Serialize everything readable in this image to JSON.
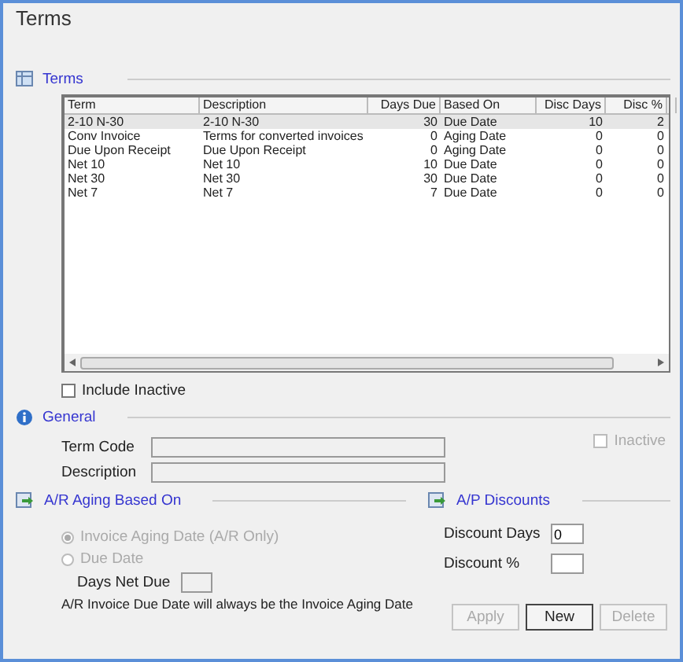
{
  "window": {
    "title": "Terms"
  },
  "terms_section": {
    "title": "Terms"
  },
  "table": {
    "columns": [
      {
        "label": "Term",
        "kind": "text"
      },
      {
        "label": "Description",
        "kind": "text"
      },
      {
        "label": "Days Due",
        "kind": "number"
      },
      {
        "label": "Based On",
        "kind": "text"
      },
      {
        "label": "Disc Days",
        "kind": "number"
      },
      {
        "label": "Disc %",
        "kind": "number"
      }
    ],
    "rows": [
      {
        "selected": true,
        "cells": [
          "2-10 N-30",
          "2-10 N-30",
          "30",
          "Due Date",
          "10",
          "2"
        ]
      },
      {
        "selected": false,
        "cells": [
          "Conv Invoice",
          "Terms for converted invoices",
          "0",
          "Aging Date",
          "0",
          "0"
        ]
      },
      {
        "selected": false,
        "cells": [
          "Due Upon Receipt",
          "Due Upon Receipt",
          "0",
          "Aging Date",
          "0",
          "0"
        ]
      },
      {
        "selected": false,
        "cells": [
          "Net 10",
          "Net 10",
          "10",
          "Due Date",
          "0",
          "0"
        ]
      },
      {
        "selected": false,
        "cells": [
          "Net 30",
          "Net 30",
          "30",
          "Due Date",
          "0",
          "0"
        ]
      },
      {
        "selected": false,
        "cells": [
          "Net 7",
          "Net 7",
          "7",
          "Due Date",
          "0",
          "0"
        ]
      }
    ]
  },
  "include_inactive": {
    "label": "Include Inactive",
    "checked": false
  },
  "general_section": {
    "title": "General",
    "fields": [
      {
        "label": "Term Code"
      },
      {
        "label": "Description"
      }
    ],
    "inactive": {
      "label": "Inactive",
      "checked": false,
      "disabled": true
    }
  },
  "aging_section": {
    "title": "A/R Aging Based On",
    "options": [
      {
        "label": "Invoice Aging Date (A/R Only)",
        "selected": true,
        "disabled": true
      },
      {
        "label": "Due Date",
        "selected": false,
        "disabled": true
      }
    ],
    "days_net_due": {
      "label": "Days Net Due"
    },
    "note": "A/R Invoice Due Date will always be the Invoice Aging Date"
  },
  "discounts_section": {
    "title": "A/P Discounts",
    "fields": [
      {
        "label": "Discount Days",
        "value": "0"
      },
      {
        "label": "Discount %"
      }
    ]
  },
  "buttons": [
    {
      "label": "Apply",
      "disabled": true
    },
    {
      "label": "New",
      "disabled": false
    },
    {
      "label": "Delete",
      "disabled": true
    }
  ]
}
